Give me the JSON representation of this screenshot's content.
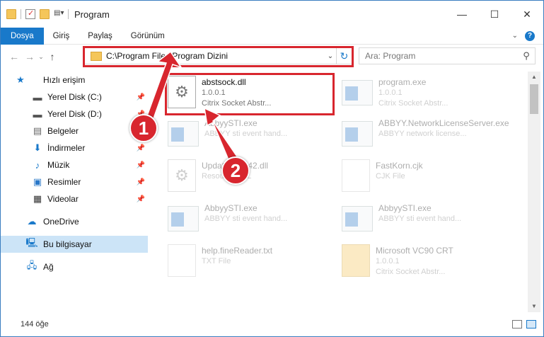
{
  "window": {
    "title": "Program",
    "controls": {
      "minimize": "—",
      "maximize": "☐",
      "close": "✕"
    }
  },
  "ribbon": {
    "tabs": [
      {
        "label": "Dosya"
      },
      {
        "label": "Giriş"
      },
      {
        "label": "Paylaş"
      },
      {
        "label": "Görünüm"
      }
    ]
  },
  "navigation": {
    "back": "←",
    "forward": "→",
    "up": "↑",
    "address": "C:\\Program Files\\Program Dizini",
    "search_placeholder": "Ara: Program"
  },
  "sidebar": {
    "items": [
      {
        "label": "Hızlı erişim",
        "icon": "star-icon"
      },
      {
        "label": "Yerel Disk (C:)",
        "icon": "drive-icon",
        "pinned": true
      },
      {
        "label": "Yerel Disk (D:)",
        "icon": "drive-icon",
        "pinned": true
      },
      {
        "label": "Belgeler",
        "icon": "document-icon",
        "pinned": true
      },
      {
        "label": "İndirmeler",
        "icon": "download-icon",
        "pinned": true
      },
      {
        "label": "Müzik",
        "icon": "music-icon",
        "pinned": true
      },
      {
        "label": "Resimler",
        "icon": "picture-icon",
        "pinned": true
      },
      {
        "label": "Videolar",
        "icon": "video-icon",
        "pinned": true
      },
      {
        "label": "OneDrive",
        "icon": "cloud-icon"
      },
      {
        "label": "Bu bilgisayar",
        "icon": "computer-icon",
        "selected": true
      },
      {
        "label": "Ağ",
        "icon": "network-icon"
      }
    ]
  },
  "files": [
    {
      "name": "abstsock.dll",
      "line2": "1.0.0.1",
      "line3": "Citrix Socket Abstr...",
      "type": "dll",
      "highlighted": true
    },
    {
      "name": "program.exe",
      "line2": "1.0.0.1",
      "line3": "Citrix Socket Abstr...",
      "type": "exe"
    },
    {
      "name": "AbbyySTI.exe",
      "line2": "ABBYY sti event hand...",
      "line3": "",
      "type": "exe"
    },
    {
      "name": "ABBYY.NetworkLicenseServer.exe",
      "line2": "ABBYY network license...",
      "line3": "",
      "type": "exe"
    },
    {
      "name": "Update...ent42.dll",
      "line2": "Resource DLL",
      "line3": "",
      "type": "dll"
    },
    {
      "name": "FastKorn.cjk",
      "line2": "CJK File",
      "line3": "",
      "type": "file"
    },
    {
      "name": "AbbyySTI.exe",
      "line2": "ABBYY sti event hand...",
      "line3": "",
      "type": "exe"
    },
    {
      "name": "AbbyySTI.exe",
      "line2": "ABBYY sti event hand...",
      "line3": "",
      "type": "exe"
    },
    {
      "name": "help.fineReader.txt",
      "line2": "TXT File",
      "line3": "",
      "type": "file"
    },
    {
      "name": "Microsoft VC90 CRT",
      "line2": "1.0.0.1",
      "line3": "Citrix Socket Abstr...",
      "type": "zip"
    }
  ],
  "status": {
    "count": "144 öğe"
  },
  "callouts": [
    "1",
    "2"
  ],
  "colors": {
    "accent": "#1979ca",
    "highlight": "#d8262e",
    "selection": "#cce4f7"
  }
}
